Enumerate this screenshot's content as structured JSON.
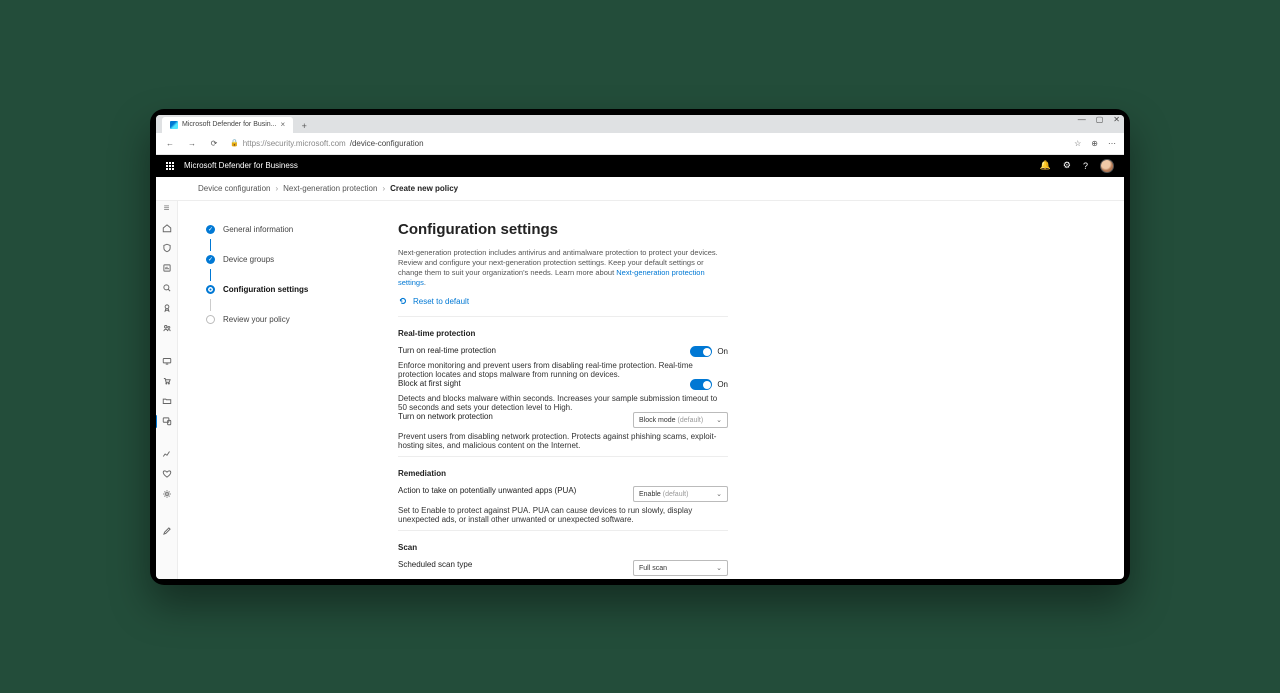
{
  "browser": {
    "tab_title": "Microsoft Defender for Busin...",
    "url_host": "https://security.microsoft.com",
    "url_path": "/device-configuration"
  },
  "app": {
    "title": "Microsoft Defender for Business"
  },
  "breadcrumb": {
    "a": "Device configuration",
    "b": "Next-generation protection",
    "c": "Create new policy"
  },
  "steps": {
    "s1": "General information",
    "s2": "Device groups",
    "s3": "Configuration settings",
    "s4": "Review your policy"
  },
  "page": {
    "title": "Configuration settings",
    "intro": "Next-generation protection includes antivirus and antimalware protection to protect your devices. Review and configure your next-generation protection settings. Keep your default settings or change them to suit your organization's needs. Learn more about ",
    "intro_link": "Next-generation protection settings",
    "reset_label": "Reset to default"
  },
  "realtime": {
    "section_title": "Real-time protection",
    "rtp_label": "Turn on real-time protection",
    "rtp_desc": "Enforce monitoring and prevent users from disabling real-time protection. Real-time protection locates and stops malware from running on devices.",
    "rtp_state": "On",
    "bafs_label": "Block at first sight",
    "bafs_desc": "Detects and blocks malware within seconds. Increases your sample submission timeout to 50 seconds and sets your detection level to High.",
    "bafs_state": "On",
    "np_label": "Turn on network protection",
    "np_desc": "Prevent users from disabling network protection. Protects against phishing scams, exploit-hosting sites, and malicious content on the Internet.",
    "np_value": "Block mode",
    "np_default": "(default)"
  },
  "remediation": {
    "section_title": "Remediation",
    "pua_label": "Action to take on potentially unwanted apps (PUA)",
    "pua_desc": "Set to Enable to protect against PUA. PUA can cause devices to run slowly, display unexpected ads, or install other unwanted or unexpected software.",
    "pua_value": "Enable",
    "pua_default": "(default)"
  },
  "scan": {
    "section_title": "Scan",
    "type_label": "Scheduled scan type",
    "type_value": "Full scan"
  }
}
